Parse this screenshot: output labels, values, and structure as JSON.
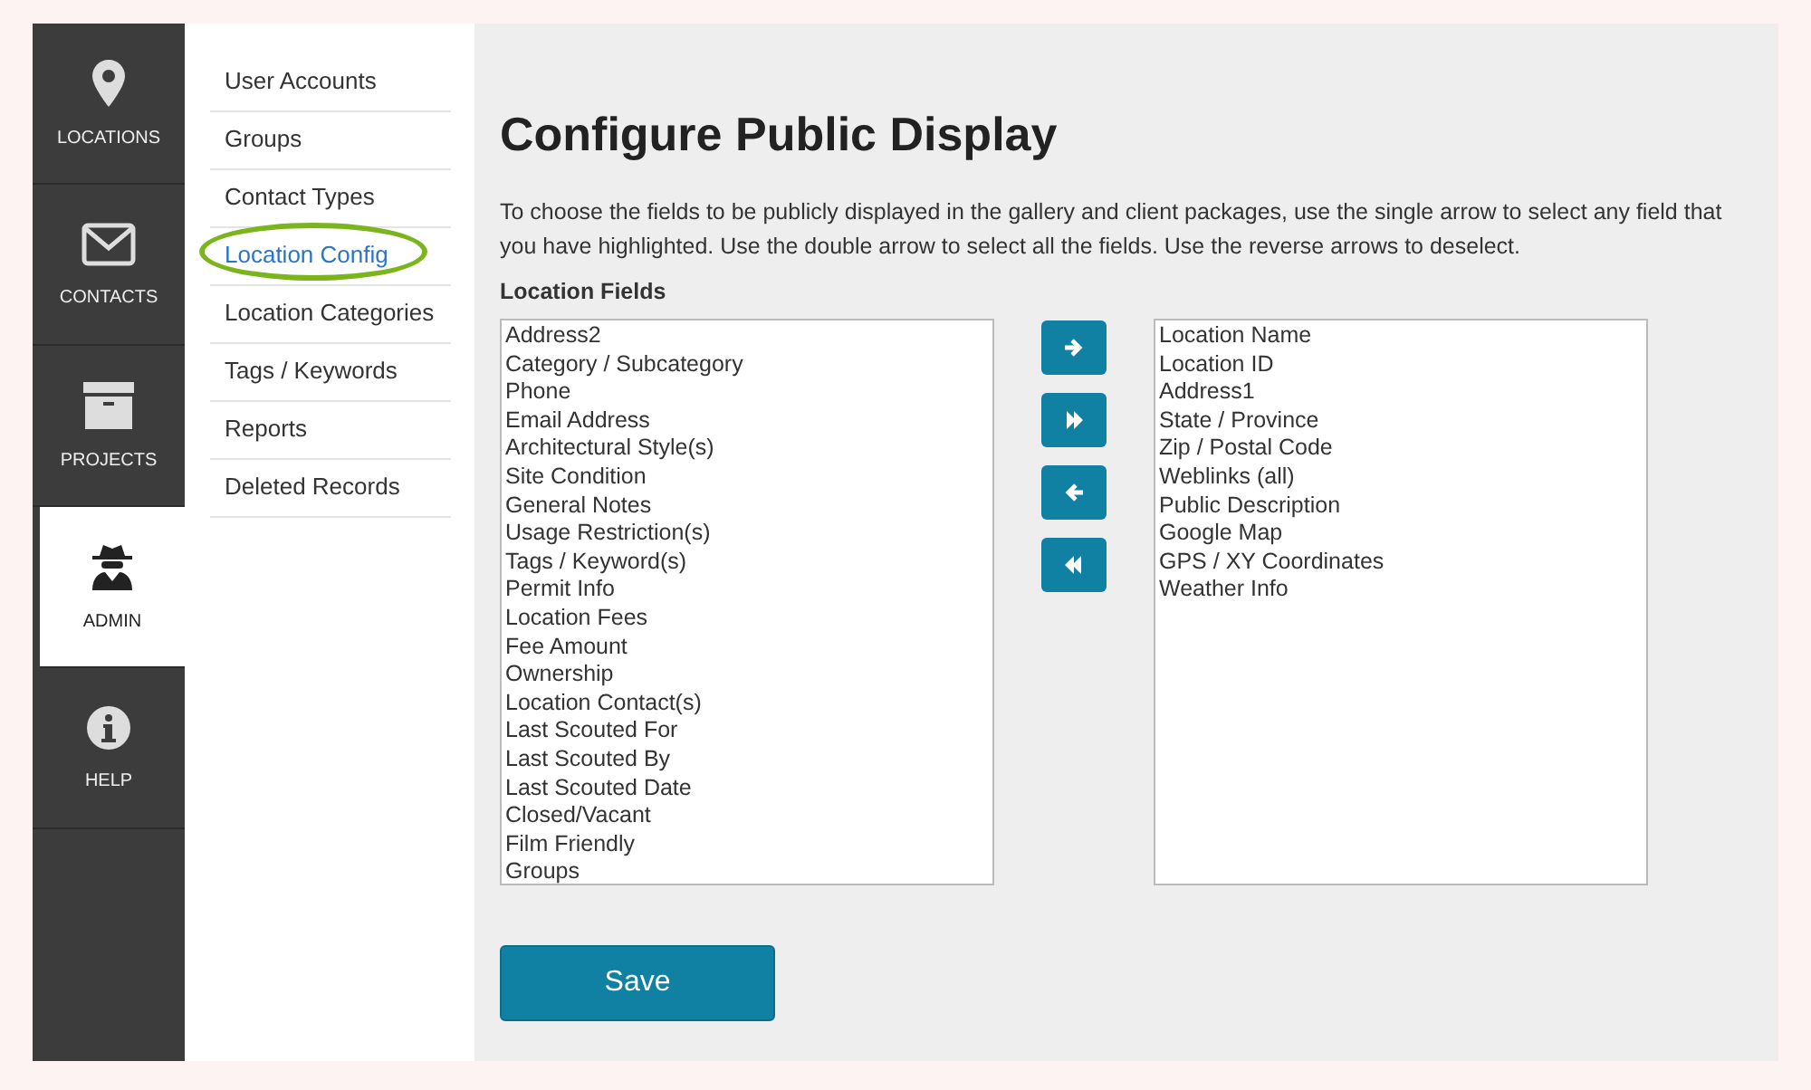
{
  "nav": [
    {
      "label": "LOCATIONS",
      "kind": "pin",
      "selected": false
    },
    {
      "label": "CONTACTS",
      "kind": "envelope",
      "selected": false
    },
    {
      "label": "PROJECTS",
      "kind": "box",
      "selected": false
    },
    {
      "label": "ADMIN",
      "kind": "spy",
      "selected": true
    },
    {
      "label": "HELP",
      "kind": "info",
      "selected": false
    }
  ],
  "submenu": [
    {
      "label": "User Accounts",
      "selected": false,
      "circled": false
    },
    {
      "label": "Groups",
      "selected": false,
      "circled": false
    },
    {
      "label": "Contact Types",
      "selected": false,
      "circled": false
    },
    {
      "label": "Location Config",
      "selected": true,
      "circled": true
    },
    {
      "label": "Location Categories",
      "selected": false,
      "circled": false
    },
    {
      "label": "Tags / Keywords",
      "selected": false,
      "circled": false
    },
    {
      "label": "Reports",
      "selected": false,
      "circled": false
    },
    {
      "label": "Deleted Records",
      "selected": false,
      "circled": false
    }
  ],
  "title": "Configure Public Display",
  "description": "To choose the fields to be publicly displayed in the gallery and client packages, use the single arrow to select any field that you have highlighted. Use the double arrow to select all the fields. Use the reverse arrows to deselect.",
  "fields_label": "Location Fields",
  "available_fields": [
    "Address2",
    "Category / Subcategory",
    "Phone",
    "Email Address",
    "Architectural Style(s)",
    "Site Condition",
    "General Notes",
    "Usage Restriction(s)",
    "Tags / Keyword(s)",
    "Permit Info",
    "Location Fees",
    "Fee Amount",
    "Ownership",
    "Location Contact(s)",
    "Last Scouted For",
    "Last Scouted By",
    "Last Scouted Date",
    "Closed/Vacant",
    "Film Friendly",
    "Groups"
  ],
  "move_buttons": [
    {
      "kind": "right"
    },
    {
      "kind": "all_right"
    },
    {
      "kind": "left"
    },
    {
      "kind": "all_left"
    }
  ],
  "selected_fields": [
    "Location Name",
    "Location ID",
    "Address1",
    "State / Province",
    "Zip / Postal Code",
    "Weblinks (all)",
    "Public Description",
    "Google Map",
    "GPS / XY Coordinates",
    "Weather Info"
  ],
  "save_button": "Save"
}
